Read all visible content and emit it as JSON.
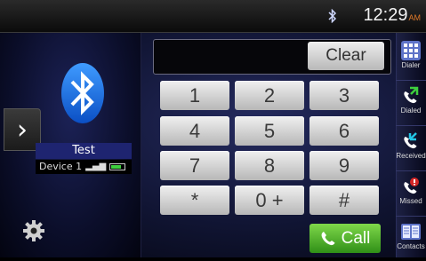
{
  "status": {
    "time": "12:29",
    "ampm": "AM"
  },
  "device": {
    "name": "Test",
    "device_label": "Device 1"
  },
  "dialer": {
    "clear_label": "Clear",
    "keys": [
      "1",
      "2",
      "3",
      "4",
      "5",
      "6",
      "7",
      "8",
      "9",
      "*",
      "0 +",
      "#"
    ],
    "call_label": "Call",
    "number_value": ""
  },
  "sidebar": {
    "items": [
      {
        "label": "Dialer",
        "icon": "dialpad-icon"
      },
      {
        "label": "Dialed",
        "icon": "dialed-phone-icon"
      },
      {
        "label": "Received",
        "icon": "received-phone-icon"
      },
      {
        "label": "Missed",
        "icon": "missed-phone-icon"
      },
      {
        "label": "Contacts",
        "icon": "contacts-book-icon"
      }
    ]
  },
  "colors": {
    "accent_green": "#3ecf3e",
    "clock_ampm": "#e07a2a",
    "device_bar": "#1e2470"
  }
}
